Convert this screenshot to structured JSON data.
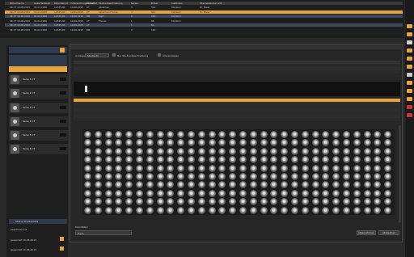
{
  "top_table": {
    "header": [
      "Patientname",
      "Geburtsdatum",
      "Patienten-ID",
      "Untersuchungsdatum",
      "Modalität",
      "Studienbeschreibung",
      "Serien",
      "Bilder",
      "Institution",
      "Überweisender Arzt"
    ],
    "rows": [
      [
        "SR CT 10.06.2015",
        "01.01.1960",
        "12345-00",
        "10.06.2015",
        "CT",
        "Abdomen",
        "3",
        "512",
        "Klinikum",
        "Dr. Meier"
      ],
      [
        "SR CT 10.06.2015",
        "01.01.1960",
        "12345-00",
        "10.06.2015",
        "CT",
        "Abdomen-Thorax",
        "4",
        "812",
        "Klinikum",
        "Dr. Meier"
      ],
      [
        "SR CT 10.06.2015",
        "01.01.1960",
        "12345-00",
        "10.06.2015",
        "MR",
        "Kopf",
        "2",
        "240",
        "Klinikum",
        ""
      ],
      [
        "SR CT 10.06.2015",
        "01.01.1960",
        "12345-00",
        "10.06.2015",
        "CT",
        "Thorax",
        "1",
        "96",
        "Klinikum",
        ""
      ],
      [
        "SR CT 10.06.2015",
        "01.01.1960",
        "12345-00",
        "10.06.2015",
        "CT",
        "",
        "1",
        "64",
        "",
        ""
      ],
      [
        "SR CT 10.06.2015",
        "01.01.1960",
        "12345-00",
        "10.06.2015",
        "MR",
        "",
        "2",
        "120",
        "",
        ""
      ]
    ]
  },
  "left_panel": {
    "series": [
      {
        "label": "Serie 1 CT"
      },
      {
        "label": "Serie 2 CT"
      },
      {
        "label": "Serie 3 CT"
      },
      {
        "label": "Serie 4 CT"
      },
      {
        "label": "Serie 5 CT"
      },
      {
        "label": "Serie 6 CT"
      }
    ],
    "status_title": "Status Studienliste",
    "status_lines": [
      "Abschluss 1/1",
      "gesendet 10.06.2015",
      "gesendet 10.06.2015"
    ]
  },
  "dialog": {
    "filter_label": "Anzeige",
    "filter_value": "Studie ID",
    "option1": "Nur Studienbeschreibung",
    "option2": "Alle anzeigen",
    "bottom_label": "Prioritäten",
    "bottom_value": "Hoch",
    "ok": "Übernehmen",
    "cancel": "Abbrechen"
  },
  "colors": {
    "accent": "#e8a43a",
    "selection": "#3c4a5c"
  }
}
